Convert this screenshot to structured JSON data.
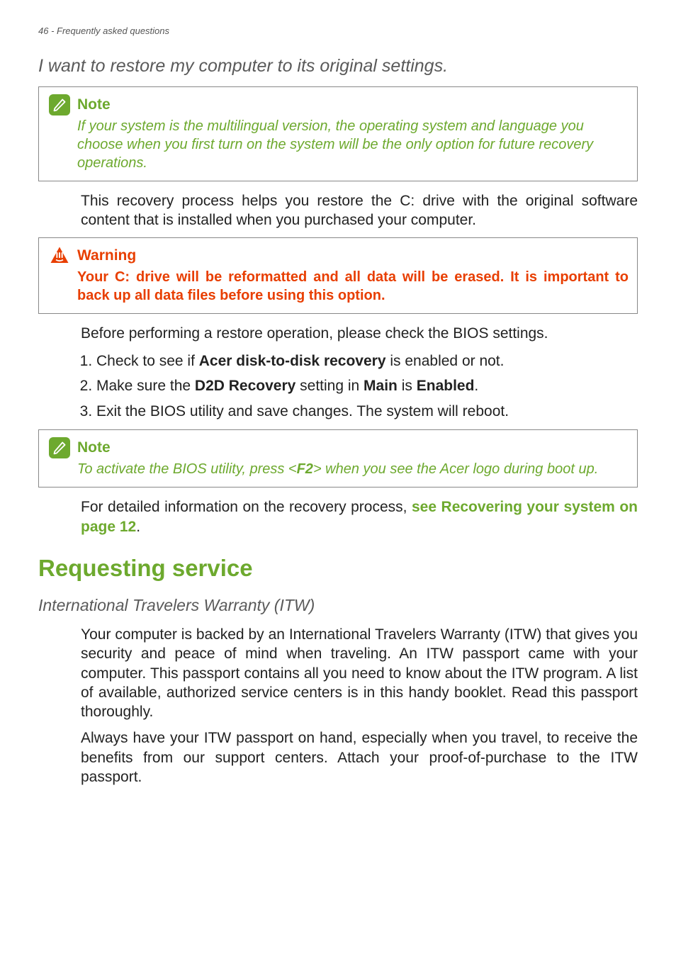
{
  "header": {
    "page_number": "46",
    "section": "Frequently asked questions"
  },
  "sections": {
    "restore_heading": "I want to restore my computer to its original settings.",
    "note1_title": "Note",
    "note1_body": "If your system is the multilingual version, the operating system and language you choose when you first turn on the system will be the only option for future recovery operations.",
    "para1": "This recovery process helps you restore the C: drive with the original software content that is installed when you purchased your computer.",
    "warning_title": "Warning",
    "warning_body": "Your C: drive will be reformatted and all data will be erased. It is important to back up all data files before using this option.",
    "para2": "Before performing a restore operation, please check the BIOS settings.",
    "step1_prefix": "Check to see if ",
    "step1_bold": "Acer disk-to-disk recovery",
    "step1_suffix": " is enabled or not.",
    "step2_prefix": "Make sure the ",
    "step2_bold1": "D2D Recovery",
    "step2_mid": " setting in ",
    "step2_bold2": "Main",
    "step2_mid2": " is ",
    "step2_bold3": "Enabled",
    "step2_suffix": ".",
    "step3": "Exit the BIOS utility and save changes. The system will reboot.",
    "note2_title": "Note",
    "note2_body_prefix": "To activate the BIOS utility, press <",
    "note2_body_bold": "F2",
    "note2_body_suffix": "> when you see the Acer logo during boot up.",
    "para3_prefix": "For detailed information on the recovery process, ",
    "para3_link": "see Recovering your system on page 12",
    "para3_suffix": ".",
    "h2": "Requesting service",
    "itw_heading": "International Travelers Warranty (ITW)",
    "itw_para1": "Your computer is backed by an International Travelers Warranty (ITW) that gives you security and peace of mind when traveling. An ITW passport came with your computer. This passport contains all you need to know about the ITW program. A list of available, authorized service centers is in this handy booklet. Read this passport thoroughly.",
    "itw_para2": "Always have your ITW passport on hand, especially when you travel, to receive the benefits from our support centers. Attach your proof-of-purchase to the ITW passport."
  }
}
